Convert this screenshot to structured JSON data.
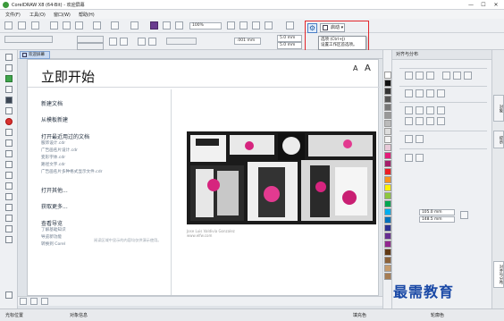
{
  "window": {
    "title": "CorelDRAW X8 (64-Bit) - 欢迎屏幕",
    "controls": [
      "—",
      "☐",
      "✕"
    ]
  },
  "menubar": {
    "items": [
      "文件(F)",
      "工具(O)",
      "窗口(W)",
      "帮助(H)"
    ]
  },
  "toolbar": {
    "zoom_value": "100%",
    "nudge_value": ".001 mm",
    "dup_x": "5.0 mm",
    "dup_y": "5.0 mm",
    "launch_label": "启动",
    "tooltip_line1": "选项 (Ctrl+J)",
    "tooltip_line2": "设置工作区首选项。"
  },
  "document_tab": {
    "label": "欢迎屏幕"
  },
  "welcome": {
    "title": "立即开始",
    "font_small": "A",
    "font_large": "A",
    "new_doc": "新建文档",
    "new_from_template": "从模板新建",
    "open_recent": "打开最近用过的文档",
    "recent_files": [
      "服饰设计.cdr",
      "广告画名片设计.cdr",
      "变形字体.cdr",
      "路径文字.cdr",
      "广告画名片多种格式显示文件.cdr"
    ],
    "open_other": "打开其他...",
    "get_more": "获取更多...",
    "guided_tour": "查看导览",
    "tour_items": [
      "了解基础知识",
      "导览新功能",
      "转换到 Corel"
    ],
    "poster_credit_1": "Jose Luis Valdivia Gonzalez",
    "poster_credit_2": "www.elfw.com",
    "footer": "阅读区域中显示的内容均仅供演示使用。"
  },
  "docker": {
    "title": "对齐与分布",
    "width_value": "105.0 mm",
    "height_value": "148.5 mm"
  },
  "right_tabs": [
    "对象",
    "对齐与分布",
    "提示"
  ],
  "status": {
    "cursor_pos": "光标位置",
    "object_info": "对象信息",
    "fill_label": "填充色",
    "outline_label": "轮廓色"
  },
  "watermark": "最需教育",
  "colors": {
    "accent_red": "#e2262b",
    "brand_green": "#3c9a3c",
    "watermark_blue": "#1a49a6"
  }
}
